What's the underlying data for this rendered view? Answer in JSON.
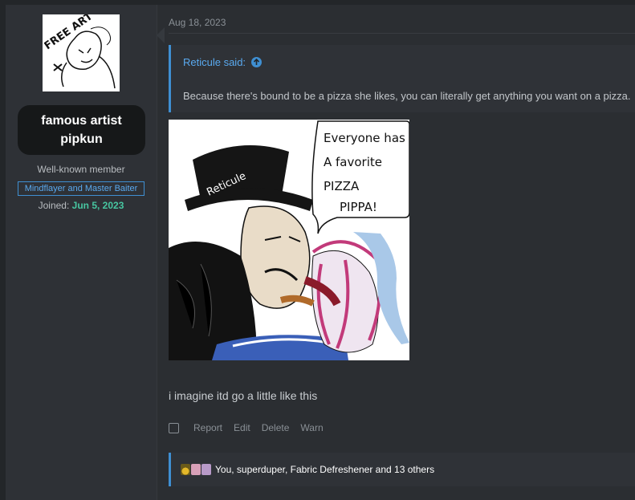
{
  "user": {
    "avatar_text": "FREE ART",
    "name": "famous artist pipkun",
    "title": "Well-known member",
    "banner": "Mindflayer and Master Baiter",
    "joined_label": "Joined:",
    "joined_date": "Jun 5, 2023"
  },
  "post": {
    "date": "Aug 18, 2023",
    "quote": {
      "author": "Reticule said:",
      "text": "Because there's bound to be a pizza she likes, you can literally get anything you want on a pizza."
    },
    "image_text": {
      "hat_label": "Reticule",
      "speech": [
        "Everyone has",
        "A favorite",
        "PIZZA",
        "PIPPA!"
      ]
    },
    "body": "i imagine itd go a little like this",
    "actions": [
      "Report",
      "Edit",
      "Delete",
      "Warn"
    ],
    "reactions_text": "You, superduper, Fabric Defreshener and 13 others"
  },
  "colors": {
    "accent": "#3f8fd2",
    "joined_date": "#47c6a1",
    "background": "#232629"
  }
}
